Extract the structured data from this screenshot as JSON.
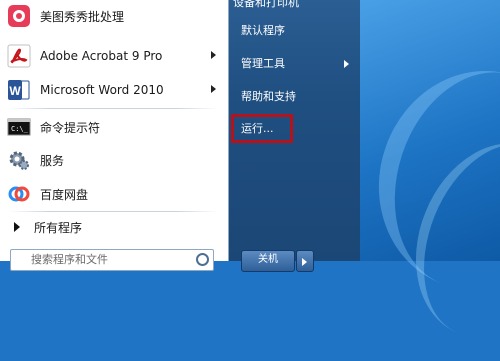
{
  "programs": [
    {
      "label": "美图秀秀批处理",
      "icon": "meitu-icon",
      "has_submenu": false
    },
    {
      "label": "Adobe Acrobat 9 Pro",
      "icon": "acrobat-icon",
      "has_submenu": true
    },
    {
      "label": "Microsoft Word 2010",
      "icon": "word-icon",
      "has_submenu": true
    },
    {
      "label": "命令提示符",
      "icon": "cmd-icon",
      "has_submenu": false
    },
    {
      "label": "服务",
      "icon": "services-gear-icon",
      "has_submenu": false
    },
    {
      "label": "百度网盘",
      "icon": "baidu-netdisk-icon",
      "has_submenu": false
    }
  ],
  "all_programs_label": "所有程序",
  "search": {
    "placeholder": "搜索程序和文件"
  },
  "right_menu": {
    "top_partial": "设备和打印机",
    "items": [
      {
        "label": "默认程序"
      },
      {
        "label": "管理工具"
      },
      {
        "label": "帮助和支持"
      },
      {
        "label": "运行..."
      }
    ]
  },
  "shutdown_label": "关机",
  "colors": {
    "highlight_border": "#b5121b",
    "right_panel": "#1f4e80",
    "desktop": "#1d74c4"
  }
}
